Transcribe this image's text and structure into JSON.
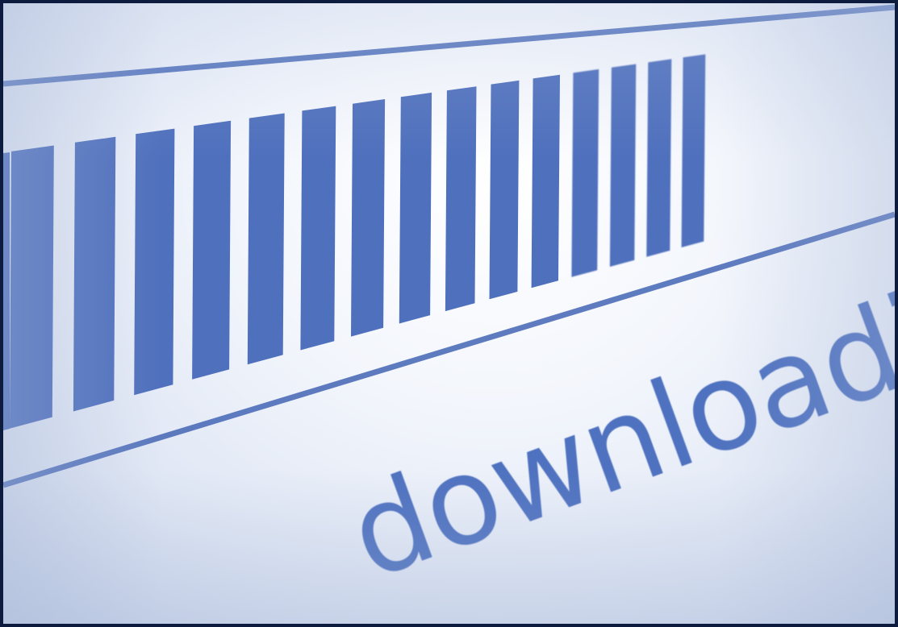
{
  "progress_bar": {
    "status_text": "downloading...",
    "filled_segments": 15,
    "progress": 0.78
  },
  "colors": {
    "segment": "#4f70bd",
    "track_line": "#4d6db8",
    "text": "#4f72c0",
    "frame_border": "#0d1b3e"
  }
}
